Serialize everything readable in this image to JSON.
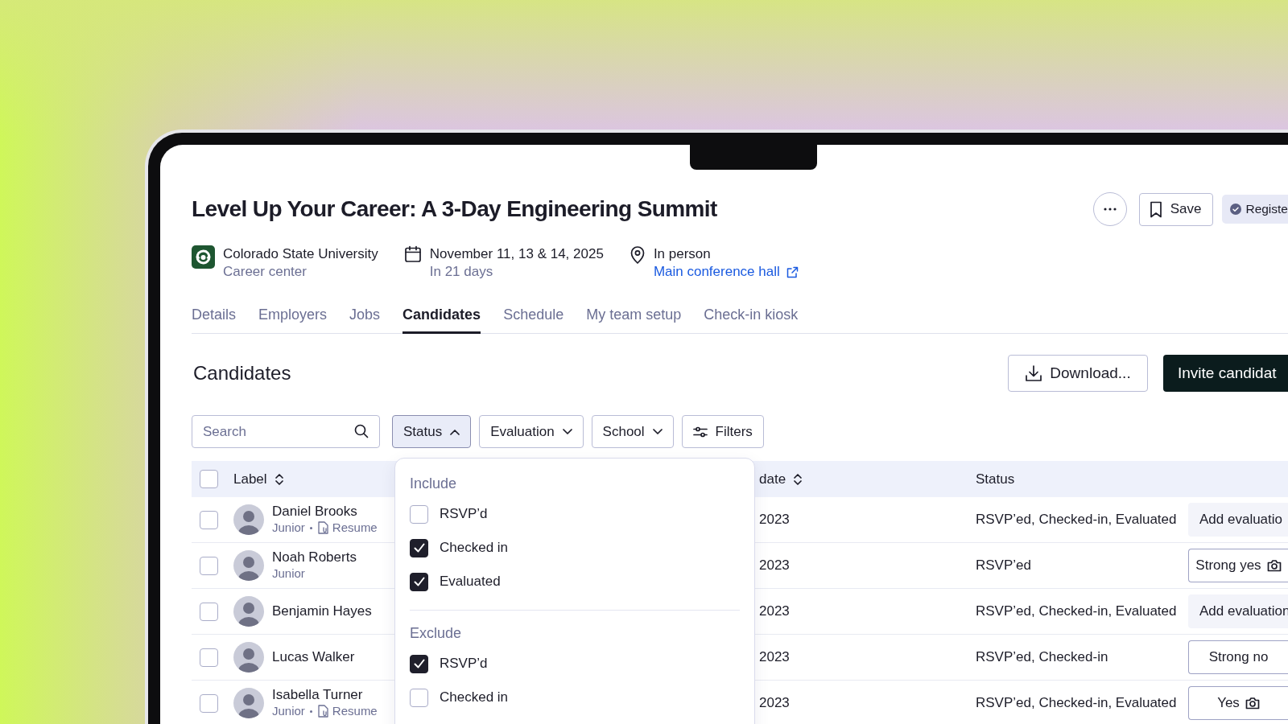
{
  "event": {
    "title": "Level Up Your Career: A 3-Day Engineering Summit",
    "organizer": {
      "name": "Colorado State University",
      "subtitle": "Career center"
    },
    "date": {
      "text": "November 11, 13 & 14, 2025",
      "subtitle": "In 21 days"
    },
    "location": {
      "text": "In person",
      "link": "Main conference hall"
    },
    "actions": {
      "save": "Save",
      "registered": "Registe"
    }
  },
  "tabs": [
    {
      "label": "Details",
      "selected": false
    },
    {
      "label": "Employers",
      "selected": false
    },
    {
      "label": "Jobs",
      "selected": false
    },
    {
      "label": "Candidates",
      "selected": true
    },
    {
      "label": "Schedule",
      "selected": false
    },
    {
      "label": "My team setup",
      "selected": false
    },
    {
      "label": "Check-in kiosk",
      "selected": false
    }
  ],
  "section": {
    "title": "Candidates",
    "download": "Download...",
    "invite": "Invite candidat"
  },
  "filters": {
    "search_placeholder": "Search",
    "buttons": [
      {
        "label": "Status",
        "kind": "dropdown",
        "expanded": true
      },
      {
        "label": "Evaluation",
        "kind": "dropdown",
        "expanded": false
      },
      {
        "label": "School",
        "kind": "dropdown",
        "expanded": false
      },
      {
        "label": "Filters",
        "kind": "filters",
        "expanded": false
      }
    ]
  },
  "table": {
    "select_all_checked": false,
    "columns": [
      {
        "label": "Label",
        "sortable": true
      },
      {
        "label": "date",
        "sortable": true
      },
      {
        "label": "Status",
        "sortable": false
      }
    ],
    "rows": [
      {
        "name": "Daniel Brooks",
        "checked": false,
        "year": "Junior",
        "resume": "Resume",
        "date": "2023",
        "status": "RSVP’ed, Checked-in, Evaluated",
        "evaluation": {
          "label": "Add evaluatio",
          "kind": "add",
          "camera": false
        }
      },
      {
        "name": "Noah Roberts",
        "checked": false,
        "year": "Junior",
        "date": "2023",
        "status": "RSVP’ed",
        "evaluation": {
          "label": "Strong yes",
          "kind": "rating",
          "camera": true
        }
      },
      {
        "name": "Benjamin Hayes",
        "checked": false,
        "date": "2023",
        "status": "RSVP’ed, Checked-in, Evaluated",
        "evaluation": {
          "label": "Add evaluation",
          "kind": "add",
          "camera": false
        }
      },
      {
        "name": "Lucas Walker",
        "checked": false,
        "date": "2023",
        "status": "RSVP’ed, Checked-in",
        "evaluation": {
          "label": "Strong no",
          "kind": "rating",
          "camera": false
        }
      },
      {
        "name": "Isabella Turner",
        "checked": false,
        "year": "Junior",
        "resume": "Resume",
        "date": "2023",
        "status": "RSVP’ed, Checked-in, Evaluated",
        "evaluation": {
          "label": "Yes",
          "kind": "rating",
          "camera": true
        }
      }
    ]
  },
  "status_menu": {
    "groups": [
      {
        "title": "Include",
        "options": [
          {
            "label": "RSVP’d",
            "checked": false
          },
          {
            "label": "Checked in",
            "checked": true
          },
          {
            "label": "Evaluated",
            "checked": true
          }
        ]
      },
      {
        "title": "Exclude",
        "options": [
          {
            "label": "RSVP’d",
            "checked": true
          },
          {
            "label": "Checked in",
            "checked": false
          }
        ]
      }
    ]
  }
}
